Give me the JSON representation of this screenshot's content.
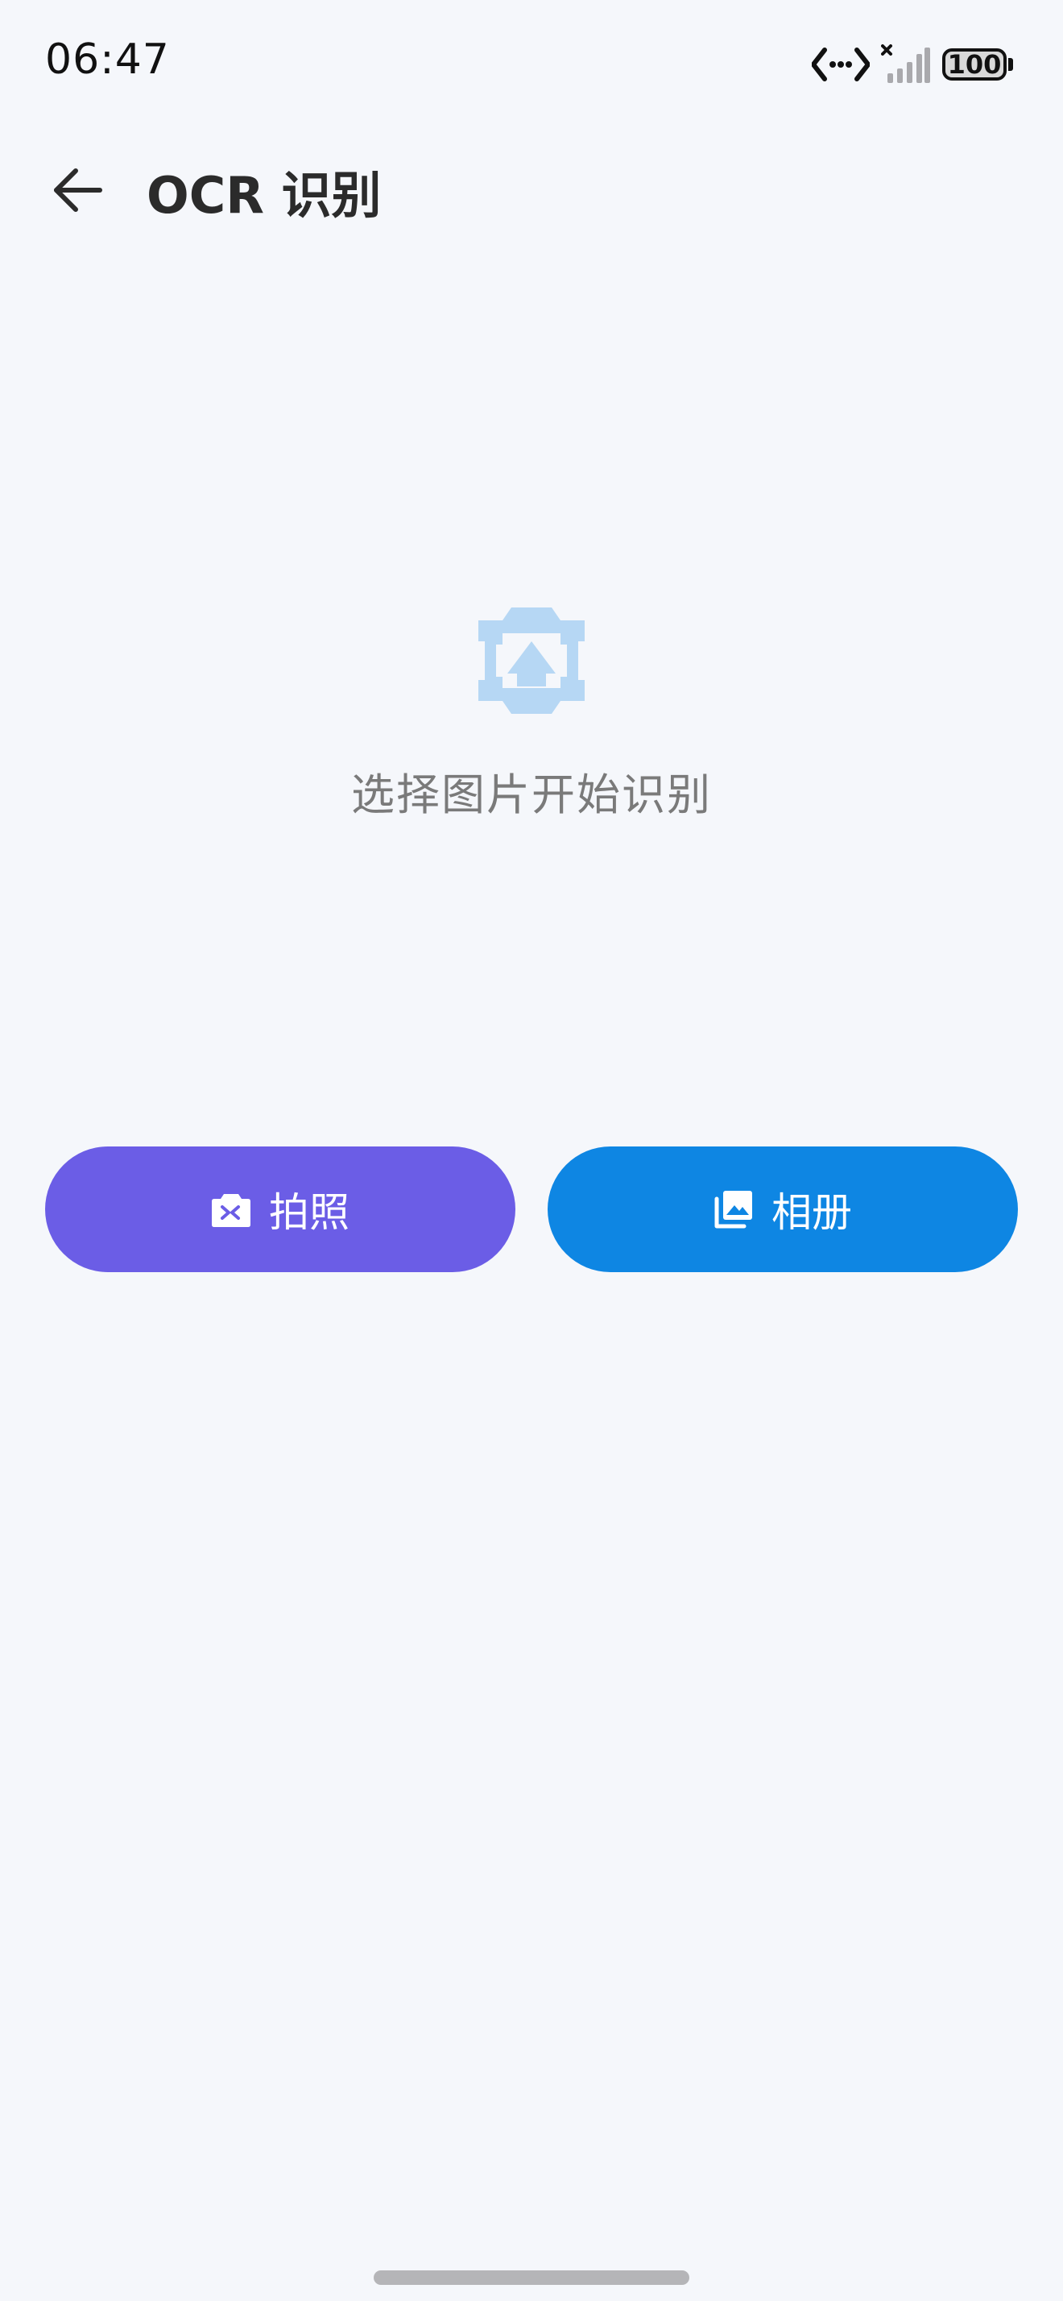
{
  "status_bar": {
    "time": "06:47",
    "battery": "100",
    "icons": [
      "dev-tools-icon",
      "signal-off-icon",
      "battery-icon"
    ]
  },
  "app_bar": {
    "title": "OCR 识别",
    "back_icon": "arrow-left-icon"
  },
  "empty_state": {
    "icon": "image-upload-icon",
    "message": "选择图片开始识别"
  },
  "actions": {
    "camera": {
      "label": "拍照",
      "icon": "camera-icon",
      "color": "#6b5de6"
    },
    "album": {
      "label": "相册",
      "icon": "gallery-icon",
      "color": "#0e86e3"
    }
  },
  "colors": {
    "background": "#f5f7fb",
    "title_text": "#2b2b2b",
    "hint_text": "#7a7a7a",
    "icon_tint": "#b6d7f4"
  }
}
